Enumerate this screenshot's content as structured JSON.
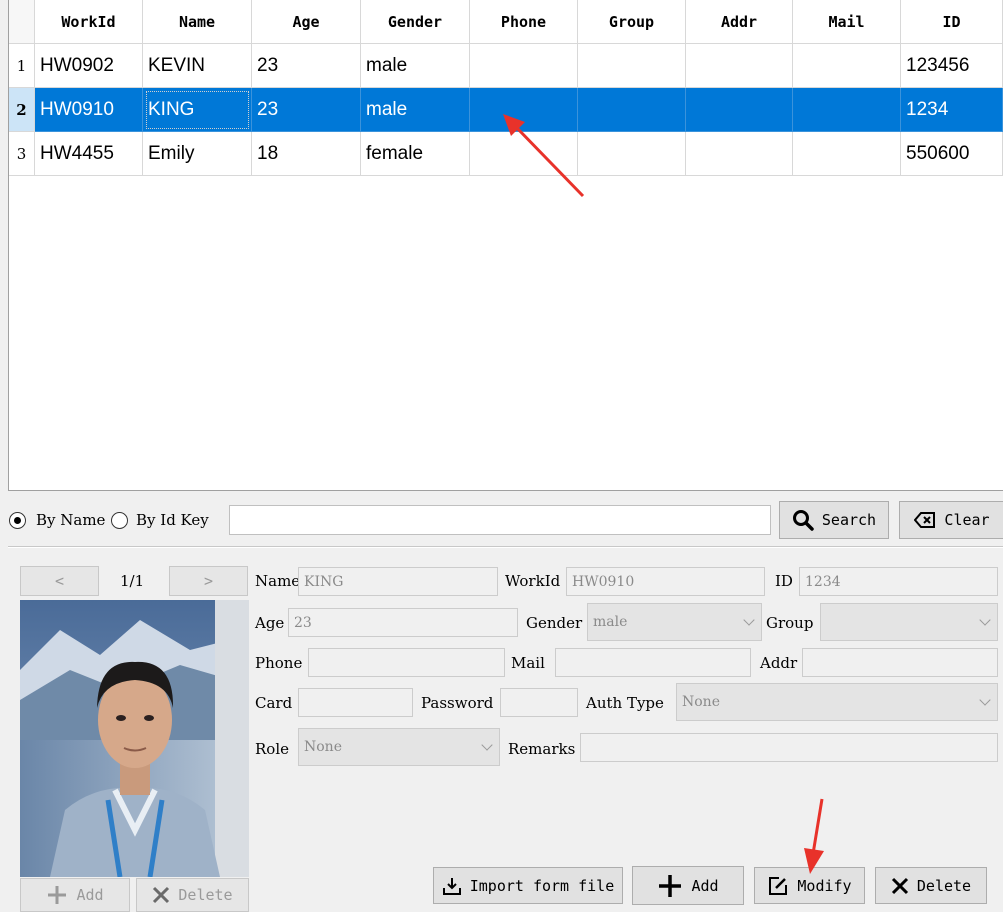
{
  "table": {
    "columns": [
      "WorkId",
      "Name",
      "Age",
      "Gender",
      "Phone",
      "Group",
      "Addr",
      "Mail",
      "ID"
    ],
    "rows": [
      {
        "num": "1",
        "cells": [
          "HW0902",
          "KEVIN",
          "23",
          "male",
          "",
          "",
          "",
          "",
          "123456"
        ]
      },
      {
        "num": "2",
        "cells": [
          "HW0910",
          "KING",
          "23",
          "male",
          "",
          "",
          "",
          "",
          "1234"
        ]
      },
      {
        "num": "3",
        "cells": [
          "HW4455",
          "Emily",
          "18",
          "female",
          "",
          "",
          "",
          "",
          "550600"
        ]
      }
    ],
    "selected_row": 2
  },
  "search": {
    "by_name_label": "By Name",
    "by_id_label": "By Id Key",
    "query": "",
    "search_button": "Search",
    "clear_button": "Clear"
  },
  "pager": {
    "text": "1/1",
    "prev_icon": "chevron-left-icon",
    "next_icon": "chevron-right-icon"
  },
  "photo_buttons": {
    "add": "Add",
    "delete": "Delete"
  },
  "form": {
    "name_label": "Name",
    "name_value": "KING",
    "workid_label": "WorkId",
    "workid_value": "HW0910",
    "id_label": "ID",
    "id_value": "1234",
    "age_label": "Age",
    "age_value": "23",
    "gender_label": "Gender",
    "gender_value": "male",
    "group_label": "Group",
    "group_value": "",
    "phone_label": "Phone",
    "phone_value": "",
    "mail_label": "Mail",
    "mail_value": "",
    "addr_label": "Addr",
    "addr_value": "",
    "card_label": "Card",
    "card_value": "",
    "password_label": "Password",
    "password_value": "",
    "authtype_label": "Auth Type",
    "authtype_value": "None",
    "role_label": "Role",
    "role_value": "None",
    "remarks_label": "Remarks",
    "remarks_value": ""
  },
  "actions": {
    "import": "Import form file",
    "add": "Add",
    "modify": "Modify",
    "delete": "Delete"
  },
  "colors": {
    "selection": "#0078d7",
    "annotation_arrow": "#e8322a"
  }
}
